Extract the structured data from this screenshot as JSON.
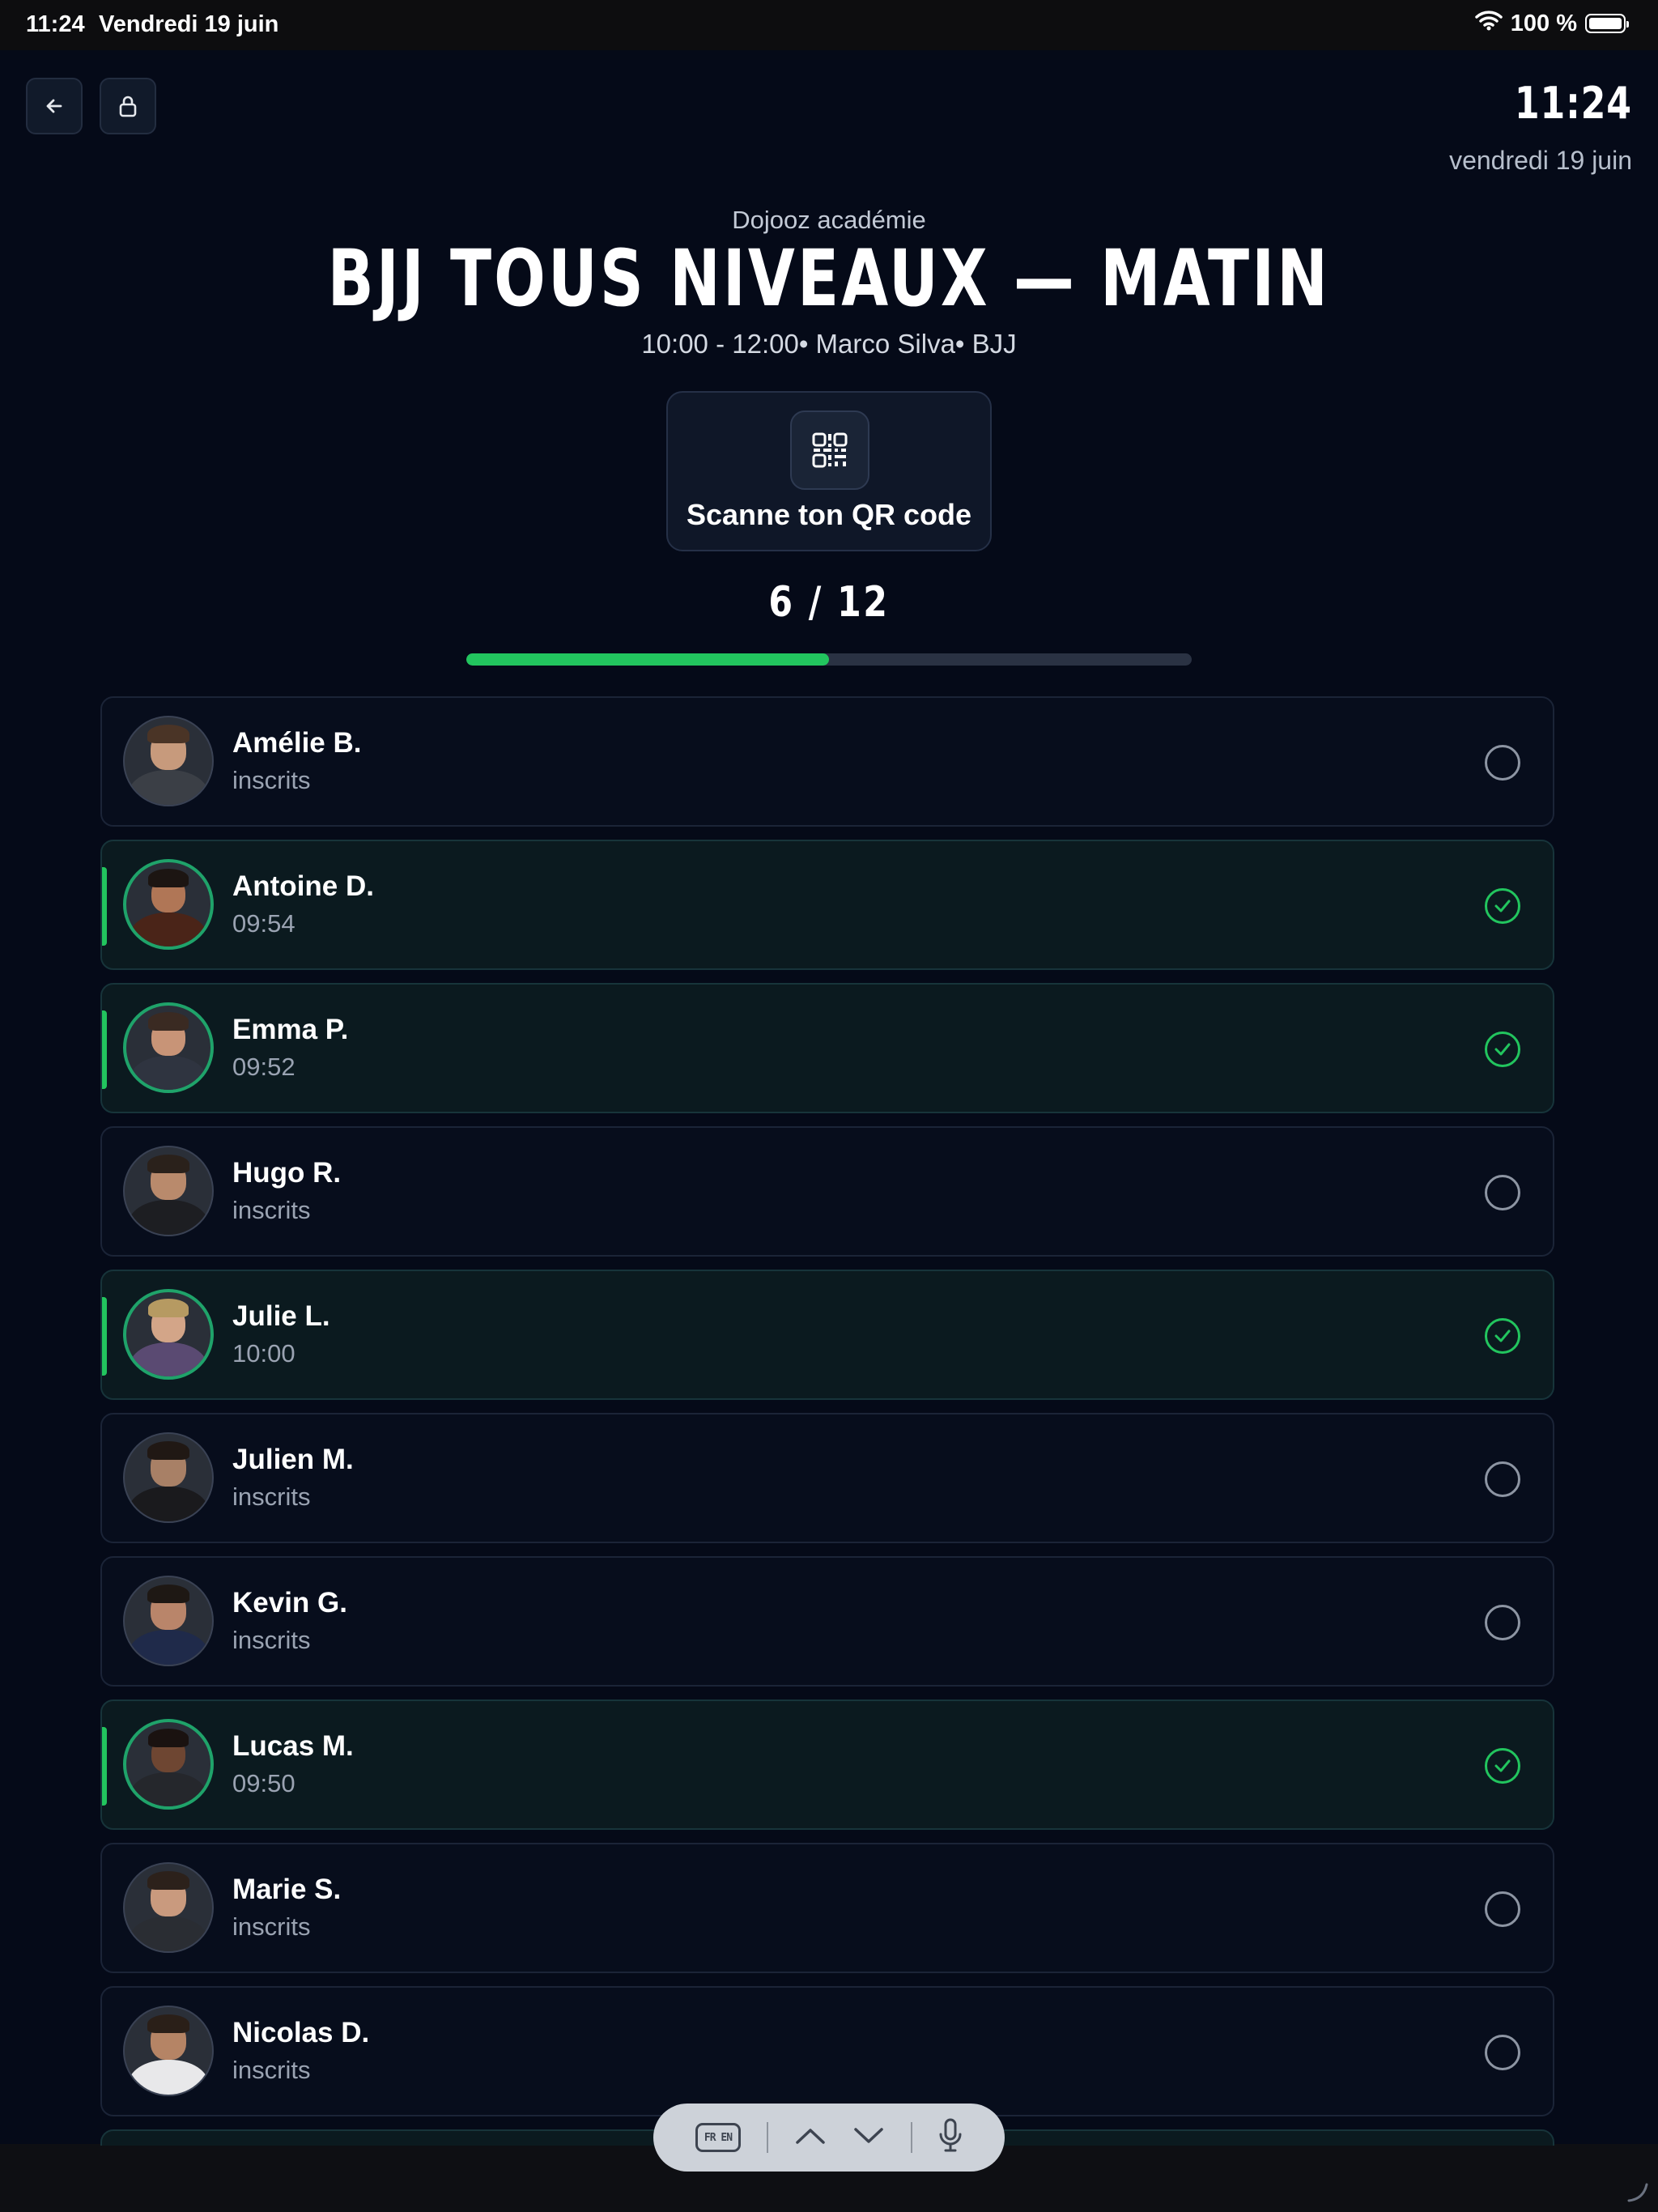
{
  "status_bar": {
    "time": "11:24",
    "date": "Vendredi 19 juin",
    "battery": "100 %"
  },
  "header": {
    "clock": "11:24",
    "date": "vendredi 19 juin",
    "academy": "Dojooz académie",
    "title": "BJJ TOUS NIVEAUX — MATIN",
    "subtitle": "10:00 - 12:00• Marco Silva• BJJ"
  },
  "qr": {
    "label": "Scanne ton QR code"
  },
  "attendance": {
    "count_label": "6 / 12",
    "progress_fraction": 0.5
  },
  "members": [
    {
      "name": "Amélie B.",
      "status": "inscrits",
      "present": false,
      "skin": "#c79a7c",
      "hair": "#4a3426",
      "shirt": "#3b3f46"
    },
    {
      "name": "Antoine D.",
      "status": "09:54",
      "present": true,
      "skin": "#b07656",
      "hair": "#1c1512",
      "shirt": "#4a2418"
    },
    {
      "name": "Emma P.",
      "status": "09:52",
      "present": true,
      "skin": "#c89477",
      "hair": "#3a2a22",
      "shirt": "#2f3440"
    },
    {
      "name": "Hugo R.",
      "status": "inscrits",
      "present": false,
      "skin": "#b98a6c",
      "hair": "#2a211b",
      "shirt": "#1d1e22"
    },
    {
      "name": "Julie L.",
      "status": "10:00",
      "present": true,
      "skin": "#d3a588",
      "hair": "#b69a62",
      "shirt": "#5a4a72"
    },
    {
      "name": "Julien M.",
      "status": "inscrits",
      "present": false,
      "skin": "#a88066",
      "hair": "#201814",
      "shirt": "#1a1a1d"
    },
    {
      "name": "Kevin G.",
      "status": "inscrits",
      "present": false,
      "skin": "#b9856a",
      "hair": "#1e1814",
      "shirt": "#1f2a4a"
    },
    {
      "name": "Lucas M.",
      "status": "09:50",
      "present": true,
      "skin": "#6e4632",
      "hair": "#1a1210",
      "shirt": "#25272c"
    },
    {
      "name": "Marie S.",
      "status": "inscrits",
      "present": false,
      "skin": "#c99a7e",
      "hair": "#2c211b",
      "shirt": "#2a2d33"
    },
    {
      "name": "Nicolas D.",
      "status": "inscrits",
      "present": false,
      "skin": "#b58465",
      "hair": "#2a1f18",
      "shirt": "#e8e8ea"
    },
    {
      "name": "",
      "status": "",
      "present": true,
      "skin": "#b58465",
      "hair": "#2a1f18",
      "shirt": "#2a2d33"
    }
  ],
  "toolbar": {
    "lang_label": "FR EN"
  },
  "icons": {
    "back": "arrow-left-icon",
    "lock": "lock-icon",
    "qr": "qr-code-icon",
    "mic": "microphone-icon"
  },
  "colors": {
    "accent": "#22c55e",
    "background": "#050a18"
  }
}
